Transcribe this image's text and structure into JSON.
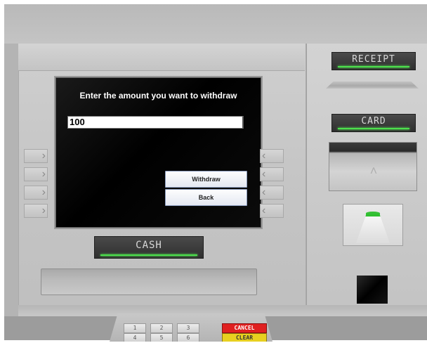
{
  "screen": {
    "title": "Enter the amount you want to withdraw",
    "amount_value": "100",
    "buttons": {
      "withdraw": "Withdraw",
      "back": "Back"
    }
  },
  "labels": {
    "receipt": "RECEIPT",
    "card": "CARD",
    "cash": "CASH"
  },
  "side_keys": {
    "left_glyph": "›",
    "right_glyph": "‹"
  },
  "keypad": {
    "row1": [
      "1",
      "2",
      "3"
    ],
    "row2": [
      "4",
      "5",
      "6"
    ],
    "cancel": "CANCEL",
    "clear": "CLEAR"
  },
  "card_arrow": "˄",
  "colors": {
    "led": "#4ce04c",
    "cancel": "#e02020",
    "clear": "#e8d020"
  }
}
